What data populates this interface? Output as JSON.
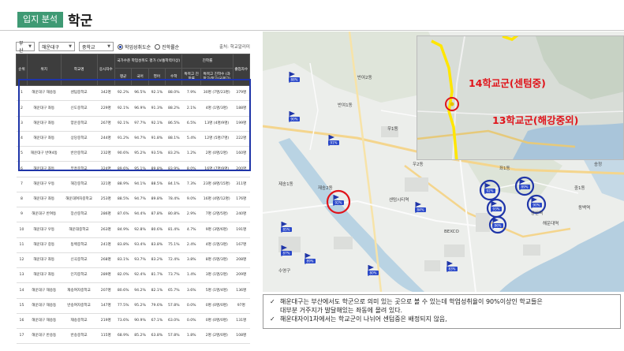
{
  "header": {
    "tag": "입지 분석",
    "title": "학군"
  },
  "filters": {
    "region": "부산",
    "district": "해운대구",
    "level": "중학교",
    "radio_1": "학업성취도순",
    "radio_2": "진학률순",
    "source": "출처: 학교알리미"
  },
  "table": {
    "head_top": [
      "순위",
      "위치",
      "학교명",
      "응시자수",
      "국가수준 학업성취도 평가 (보통학력이상)",
      "진학률",
      "졸업자수"
    ],
    "head_sub_achieve": [
      "평균",
      "국어",
      "영어",
      "수학"
    ],
    "head_sub_advance": [
      "특목고 진학률",
      "특목고 진학수 (과학고/외고/국제고)"
    ],
    "rows": [
      {
        "rank": "1",
        "loc": "해운대구 재송동",
        "school": "센텀중학교",
        "n": "342명",
        "avg": "92.2%",
        "kor": "96.5%",
        "eng": "92.1%",
        "math": "88.0%",
        "rate": "7.9%",
        "cnt": "30명 (7명/23명)",
        "grad": "379명"
      },
      {
        "rank": "2",
        "loc": "해운대구 좌동",
        "school": "신도중학교",
        "n": "229명",
        "avg": "92.1%",
        "kor": "96.9%",
        "eng": "91.3%",
        "math": "88.2%",
        "rate": "2.1%",
        "cnt": "4명 (1명/3명)",
        "grad": "188명"
      },
      {
        "rank": "3",
        "loc": "해운대구 좌동",
        "school": "양운중학교",
        "n": "267명",
        "avg": "92.1%",
        "kor": "97.7%",
        "eng": "92.1%",
        "math": "86.5%",
        "rate": "6.5%",
        "cnt": "13명 (4명/9명)",
        "grad": "199명"
      },
      {
        "rank": "4",
        "loc": "해운대구 좌동",
        "school": "상당중학교",
        "n": "244명",
        "avg": "91.2%",
        "kor": "94.7%",
        "eng": "91.8%",
        "math": "88.1%",
        "rate": "5.4%",
        "cnt": "12명 (5명/7명)",
        "grad": "222명"
      },
      {
        "rank": "5",
        "loc": "해운대구 반여4동",
        "school": "반안중학교",
        "n": "232명",
        "avg": "90.6%",
        "kor": "95.2%",
        "eng": "93.5%",
        "math": "83.2%",
        "rate": "1.2%",
        "cnt": "2명 (0명/2명)",
        "grad": "160명"
      },
      {
        "rank": "6",
        "loc": "해운대구 좌동",
        "school": "부흥중학교",
        "n": "324명",
        "avg": "89.6%",
        "kor": "95.1%",
        "eng": "89.8%",
        "math": "83.9%",
        "rate": "8.0%",
        "cnt": "16명 (7명/9명)",
        "grad": "200명"
      },
      {
        "rank": "7",
        "loc": "해운대구 우동",
        "school": "해강중학교",
        "n": "321명",
        "avg": "88.9%",
        "kor": "94.1%",
        "eng": "88.5%",
        "math": "84.1%",
        "rate": "7.3%",
        "cnt": "23명 (8명/15명)",
        "grad": "311명"
      },
      {
        "rank": "8",
        "loc": "해운대구 좌동",
        "school": "해운대여자중학교",
        "n": "253명",
        "avg": "88.5%",
        "kor": "94.7%",
        "eng": "89.8%",
        "math": "78.4%",
        "rate": "9.0%",
        "cnt": "16명 (4명/12명)",
        "grad": "176명"
      },
      {
        "rank": "9",
        "loc": "해운대구 반여동",
        "school": "장산중학교",
        "n": "286명",
        "avg": "87.6%",
        "kor": "94.4%",
        "eng": "87.8%",
        "math": "80.8%",
        "rate": "2.9%",
        "cnt": "7명 (2명/5명)",
        "grad": "240명"
      },
      {
        "rank": "10",
        "loc": "해운대구 우동",
        "school": "해운대중학교",
        "n": "263명",
        "avg": "84.9%",
        "kor": "92.8%",
        "eng": "80.6%",
        "math": "81.4%",
        "rate": "4.7%",
        "cnt": "9명 (3명/6명)",
        "grad": "191명"
      },
      {
        "rank": "11",
        "loc": "해운대구 중동",
        "school": "동백중학교",
        "n": "241명",
        "avg": "83.8%",
        "kor": "93.4%",
        "eng": "83.8%",
        "math": "75.1%",
        "rate": "2.4%",
        "cnt": "4명 (1명/3명)",
        "grad": "167명"
      },
      {
        "rank": "12",
        "loc": "해운대구 좌동",
        "school": "신곡중학교",
        "n": "268명",
        "avg": "83.1%",
        "kor": "93.7%",
        "eng": "83.2%",
        "math": "72.4%",
        "rate": "3.8%",
        "cnt": "8명 (5명/3명)",
        "grad": "208명"
      },
      {
        "rank": "13",
        "loc": "해운대구 좌동",
        "school": "인지중학교",
        "n": "289명",
        "avg": "82.0%",
        "kor": "92.4%",
        "eng": "81.7%",
        "math": "73.7%",
        "rate": "1.4%",
        "cnt": "3명 (1명/2명)",
        "grad": "209명"
      },
      {
        "rank": "14",
        "loc": "해운대구 재송동",
        "school": "재송여자중학교",
        "n": "207명",
        "avg": "80.6%",
        "kor": "94.2%",
        "eng": "82.1%",
        "math": "65.7%",
        "rate": "3.6%",
        "cnt": "5명 (1명/4명)",
        "grad": "136명"
      },
      {
        "rank": "15",
        "loc": "해운대구 재송동",
        "school": "반송여자중학교",
        "n": "147명",
        "avg": "77.5%",
        "kor": "95.2%",
        "eng": "79.6%",
        "math": "57.8%",
        "rate": "0.0%",
        "cnt": "0명 (0명/0명)",
        "grad": "97명"
      },
      {
        "rank": "16",
        "loc": "해운대구 재송동",
        "school": "재송중학교",
        "n": "219명",
        "avg": "73.6%",
        "kor": "90.9%",
        "eng": "67.1%",
        "math": "63.0%",
        "rate": "0.0%",
        "cnt": "0명 (0명/0명)",
        "grad": "131명"
      },
      {
        "rank": "17",
        "loc": "해운대구 반송동",
        "school": "반송중학교",
        "n": "115명",
        "avg": "68.9%",
        "kor": "85.2%",
        "eng": "63.8%",
        "math": "57.8%",
        "rate": "1.8%",
        "cnt": "2명 (2명/0명)",
        "grad": "108명"
      }
    ]
  },
  "map": {
    "callout_1": "14학교군(센텀중)",
    "callout_2": "13학교군(해강중외)",
    "labels": [
      "해운대구",
      "제송1동",
      "재송2동",
      "우1동",
      "우2동",
      "좌1동",
      "좌2동",
      "중1동",
      "장산역",
      "센텀시티역",
      "반여1동",
      "반여2동",
      "수영구",
      "BEXCO",
      "동백역",
      "해운대역",
      "송정"
    ],
    "markers": [
      "88%",
      "90%",
      "91%",
      "85%",
      "92%",
      "89%",
      "80%",
      "87%",
      "84%",
      "83%",
      "92%",
      "93%",
      "89%",
      "90%",
      "86%"
    ]
  },
  "notes": [
    "해운대구는 부산에서도 학군으로 의미 있는 곳으로 볼 수 있는데 학업성취율이 90%이상인 학교들은",
    "대부분 거주지가 발달해있는 좌동에 몰려 있다.",
    "해운대자이1차에서는 학교군이 나뉘어 센텀중은 배정되지 않음,"
  ],
  "colors": {
    "accent": "#3f9a74",
    "highlight": "#1f35a8",
    "callout": "#e0141b",
    "river": "#b9d3e3",
    "sea": "#b5cfe0"
  }
}
